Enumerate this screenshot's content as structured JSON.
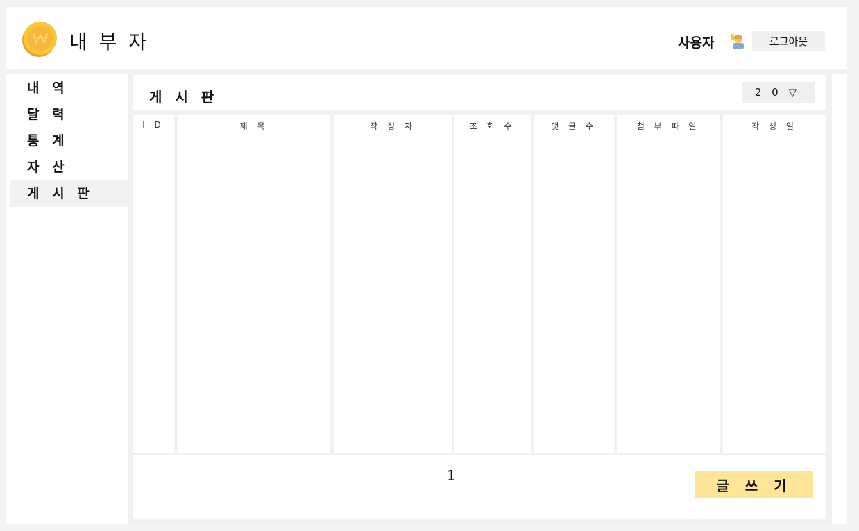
{
  "header": {
    "brand": "내 부 자",
    "user_label": "사용자",
    "logout_label": "로그아웃",
    "user_icon": "person-raising-hand-icon",
    "logo_icon": "won-coin-icon"
  },
  "sidebar": {
    "items": [
      {
        "label": "내 역"
      },
      {
        "label": "달 력"
      },
      {
        "label": "통 계"
      },
      {
        "label": "자 산"
      },
      {
        "label": "게 시 판",
        "active": true
      }
    ]
  },
  "board": {
    "title": "게 시 판",
    "per_page": "2 0 ▽",
    "columns": [
      "I D",
      "제 목",
      "작 성 자",
      "조 회 수",
      "댓 글 수",
      "첨 부 파 일",
      "작 성 일"
    ],
    "rows": [],
    "page": "1",
    "write_label": "글 쓰 기"
  },
  "colors": {
    "accent": "#ffe597",
    "coin": "#f5b82a",
    "background": "#f3f3f5"
  }
}
